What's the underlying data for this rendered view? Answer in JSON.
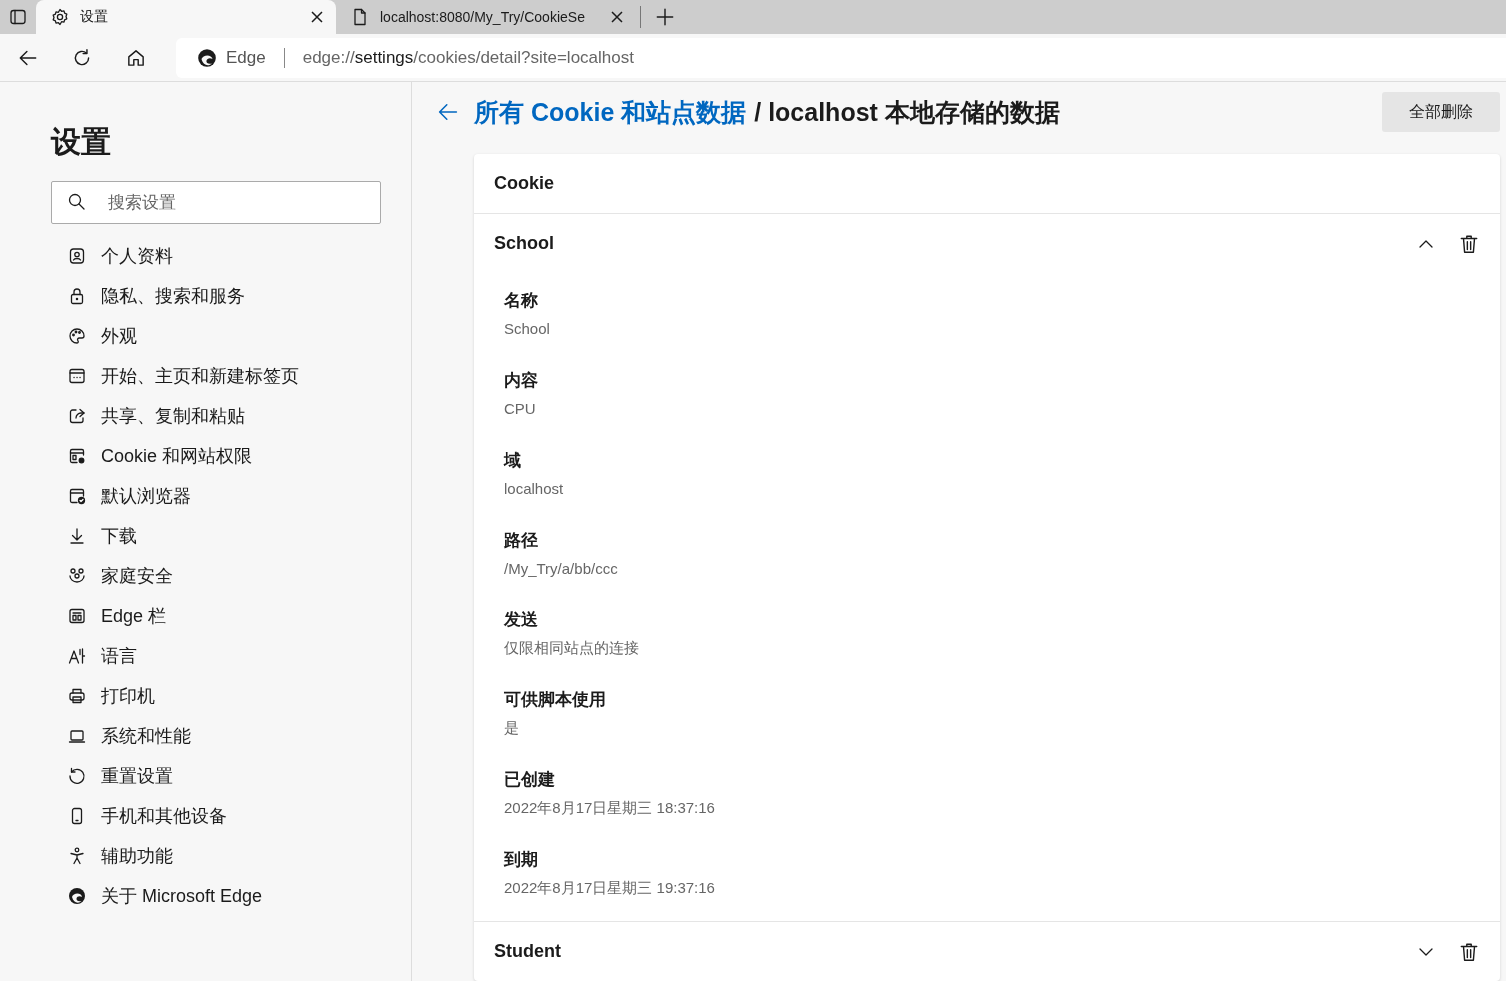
{
  "tabs": [
    {
      "title": "设置",
      "selected": true,
      "kind": "settings"
    },
    {
      "title": "localhost:8080/My_Try/CookieSe",
      "selected": false,
      "kind": "page"
    }
  ],
  "address_bar": {
    "site_label": "Edge",
    "url_prefix": "edge://",
    "url_host": "settings",
    "url_rest": "/cookies/detail?site=localhost"
  },
  "sidebar": {
    "title": "设置",
    "search": {
      "placeholder": "搜索设置"
    },
    "items": [
      {
        "label": "个人资料",
        "selected": false
      },
      {
        "label": "隐私、搜索和服务",
        "selected": false
      },
      {
        "label": "外观",
        "selected": false
      },
      {
        "label": "开始、主页和新建标签页",
        "selected": false
      },
      {
        "label": "共享、复制和粘贴",
        "selected": false
      },
      {
        "label": "Cookie 和网站权限",
        "selected": false
      },
      {
        "label": "默认浏览器",
        "selected": false
      },
      {
        "label": "下载",
        "selected": false
      },
      {
        "label": "家庭安全",
        "selected": false
      },
      {
        "label": "Edge 栏",
        "selected": false
      },
      {
        "label": "语言",
        "selected": false
      },
      {
        "label": "打印机",
        "selected": false
      },
      {
        "label": "系统和性能",
        "selected": false
      },
      {
        "label": "重置设置",
        "selected": false
      },
      {
        "label": "手机和其他设备",
        "selected": false
      },
      {
        "label": "辅助功能",
        "selected": false
      },
      {
        "label": "关于 Microsoft Edge",
        "selected": false
      }
    ]
  },
  "header": {
    "link": "所有 Cookie 和站点数据",
    "title": "/ localhost 本地存储的数据",
    "delete_all": "全部删除"
  },
  "card": {
    "title": "Cookie",
    "cookies": [
      {
        "name": "School",
        "expanded": true,
        "fields": [
          {
            "label": "名称",
            "value": "School"
          },
          {
            "label": "内容",
            "value": "CPU"
          },
          {
            "label": "域",
            "value": "localhost"
          },
          {
            "label": "路径",
            "value": "/My_Try/a/bb/ccc"
          },
          {
            "label": "发送",
            "value": "仅限相同站点的连接"
          },
          {
            "label": "可供脚本使用",
            "value": "是"
          },
          {
            "label": "已创建",
            "value": "2022年8月17日星期三 18:37:16"
          },
          {
            "label": "到期",
            "value": "2022年8月17日星期三 19:37:16"
          }
        ]
      },
      {
        "name": "Student",
        "expanded": false
      }
    ]
  }
}
